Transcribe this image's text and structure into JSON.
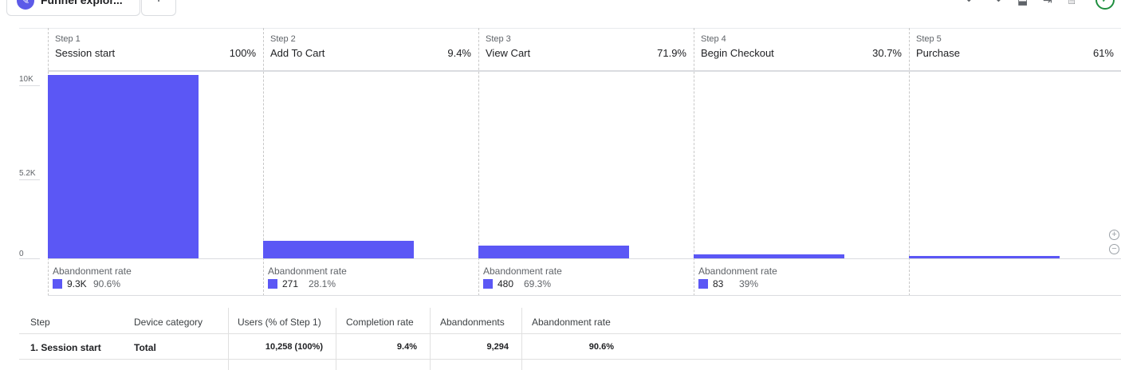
{
  "tab": {
    "label": "Funnel explor...",
    "icon": "funnel-pen-icon"
  },
  "toolbar": {
    "icons": [
      "undo-icon",
      "redo-icon",
      "download-icon",
      "share-icon",
      "insights-icon",
      "status-check-icon"
    ]
  },
  "chart_data": {
    "type": "bar",
    "categories": [
      "Session start",
      "Add To Cart",
      "View Cart",
      "Begin Checkout",
      "Purchase"
    ],
    "step_labels": [
      "Step 1",
      "Step 2",
      "Step 3",
      "Step 4",
      "Step 5"
    ],
    "step_percent": [
      "100%",
      "9.4%",
      "71.9%",
      "30.7%",
      "61%"
    ],
    "values": [
      10258,
      964,
      693,
      213,
      130
    ],
    "yticks": [
      "10K",
      "5.2K",
      "0"
    ],
    "ylim": [
      0,
      10258
    ],
    "abandonment": [
      {
        "title": "Abandonment rate",
        "count": "9.3K",
        "rate": "90.6%"
      },
      {
        "title": "Abandonment rate",
        "count": "271",
        "rate": "28.1%"
      },
      {
        "title": "Abandonment rate",
        "count": "480",
        "rate": "69.3%"
      },
      {
        "title": "Abandonment rate",
        "count": "83",
        "rate": "39%"
      }
    ],
    "bar_color": "#5b57f5"
  },
  "table": {
    "headers": [
      "Step",
      "Device category",
      "Users (% of Step 1)",
      "Completion rate",
      "Abandonments",
      "Abandonment rate"
    ],
    "rows": [
      [
        "1. Session start",
        "Total",
        "10,258 (100%)",
        "9.4%",
        "9,294",
        "90.6%"
      ]
    ]
  },
  "zoom": {
    "in": "+",
    "out": "−"
  }
}
